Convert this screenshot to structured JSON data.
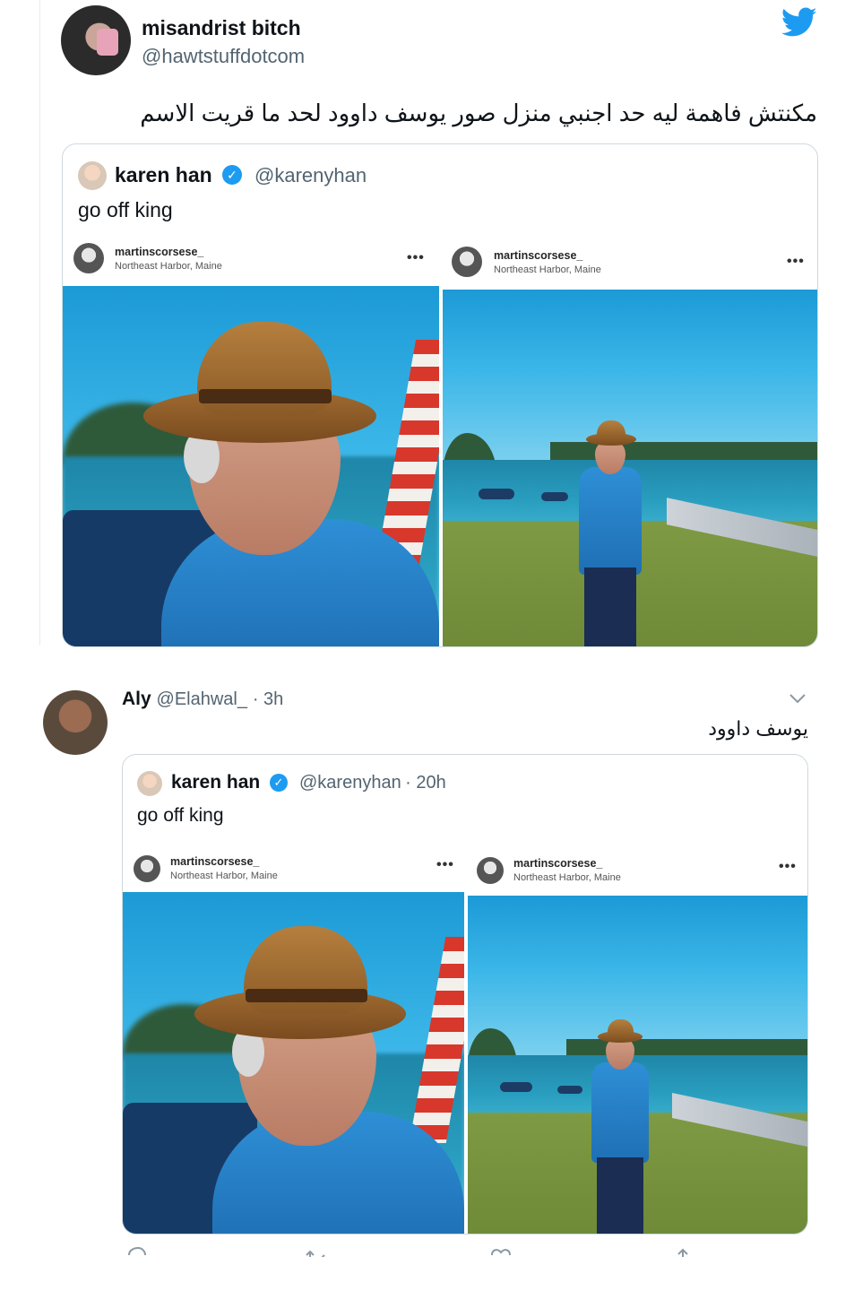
{
  "tweet1": {
    "display_name": "misandrist bitch",
    "handle": "@hawtstuffdotcom",
    "text": "مكنتش فاهمة ليه حد اجنبي منزل صور يوسف داوود لحد ما قريت الاسم",
    "brand_icon": "twitter-bird-icon",
    "brand_color": "#1d9bf0",
    "quoted": {
      "display_name": "karen han",
      "handle": "@karenyhan",
      "verified_icon": "verified-badge-icon",
      "text": "go off king",
      "images": [
        {
          "ig_user": "martinscorsese_",
          "ig_location": "Northeast Harbor, Maine",
          "more": "•••"
        },
        {
          "ig_user": "martinscorsese_",
          "ig_location": "Northeast Harbor, Maine",
          "more": "•••"
        }
      ]
    }
  },
  "tweet2": {
    "display_name": "Aly",
    "handle": "@Elahwal_",
    "time": "· 3h",
    "menu_icon": "chevron-down-icon",
    "text": "يوسف داوود",
    "quoted": {
      "display_name": "karen han",
      "handle": "@karenyhan",
      "time": "· 20h",
      "verified_icon": "verified-badge-icon",
      "text": "go off king",
      "images": [
        {
          "ig_user": "martinscorsese_",
          "ig_location": "Northeast Harbor, Maine",
          "more": "•••"
        },
        {
          "ig_user": "martinscorsese_",
          "ig_location": "Northeast Harbor, Maine",
          "more": "•••"
        }
      ]
    },
    "actions": [
      {
        "icon": "reply-icon"
      },
      {
        "icon": "retweet-icon"
      },
      {
        "icon": "like-icon"
      },
      {
        "icon": "share-icon"
      }
    ]
  }
}
